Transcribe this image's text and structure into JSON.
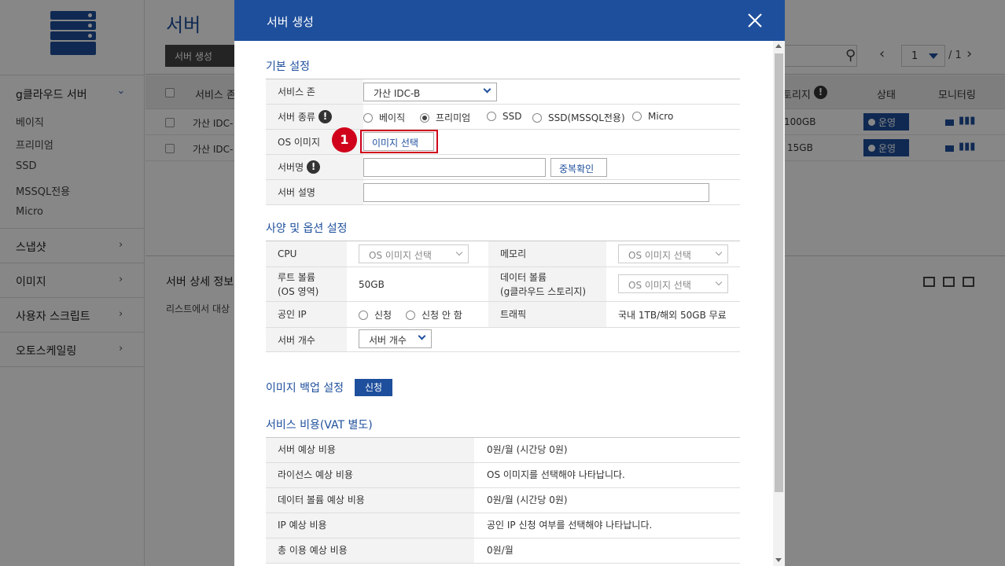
{
  "background": {
    "page_title": "서버",
    "create_button": "서버 생성",
    "pagination": {
      "current": "1",
      "total": "/ 1"
    },
    "sidebar": {
      "groups": [
        {
          "label": "g클라우드 서버",
          "expanded": true
        },
        {
          "label": "스냅샷"
        },
        {
          "label": "이미지"
        },
        {
          "label": "사용자 스크립트"
        },
        {
          "label": "오토스케일링"
        }
      ],
      "sub_items": [
        "베이직",
        "프리미엄",
        "SSD",
        "MSSQL전용",
        "Micro"
      ]
    },
    "table": {
      "headers": {
        "zone": "서비스 존",
        "storage": "토리지",
        "status": "상태",
        "monitoring": "모니터링"
      },
      "rows": [
        {
          "zone": "가산 IDC-",
          "storage": "100GB",
          "status": "운영"
        },
        {
          "zone": "가산 IDC-",
          "storage": "15GB",
          "status": "운영"
        }
      ]
    },
    "detail": {
      "title": "서버 상세 정보",
      "hint": "리스트에서 대상"
    }
  },
  "modal": {
    "title": "서버 생성",
    "basic": {
      "section_title": "기본 설정",
      "zone_label": "서비스 존",
      "zone_value": "가산 IDC-B",
      "type_label": "서버 종류",
      "types": [
        {
          "label": "베이직",
          "selected": false
        },
        {
          "label": "프리미엄",
          "selected": true
        },
        {
          "label": "SSD",
          "selected": false
        },
        {
          "label": "SSD(MSSQL전용)",
          "selected": false
        },
        {
          "label": "Micro",
          "selected": false
        }
      ],
      "os_label": "OS 이미지",
      "os_button": "이미지 선택",
      "step_number": "1",
      "name_label": "서버명",
      "name_value": "",
      "dup_check": "중복확인",
      "desc_label": "서버 설명",
      "desc_value": ""
    },
    "spec": {
      "section_title": "사양 및 옵션 설정",
      "cpu_label": "CPU",
      "cpu_value": "OS 이미지 선택",
      "memory_label": "메모리",
      "memory_value": "OS 이미지 선택",
      "root_label_1": "루트 볼륨",
      "root_label_2": "(OS 영역)",
      "root_value": "50GB",
      "data_label_1": "데이터 볼륨",
      "data_label_2": "(g클라우드 스토리지)",
      "data_value": "OS 이미지 선택",
      "ip_label": "공인 IP",
      "ip_options": [
        {
          "label": "신청",
          "selected": false
        },
        {
          "label": "신청 안 함",
          "selected": false
        }
      ],
      "traffic_label": "트래픽",
      "traffic_value": "국내 1TB/해외 50GB 무료",
      "count_label": "서버 개수",
      "count_value": "서버 개수"
    },
    "backup": {
      "section_title": "이미지 백업 설정",
      "apply_button": "신청"
    },
    "cost": {
      "section_title": "서비스 비용(VAT 별도)",
      "rows": [
        {
          "label": "서버 예상 비용",
          "value": "0원/월 (시간당 0원)"
        },
        {
          "label": "라이선스 예상 비용",
          "value": "OS 이미지를 선택해야 나타납니다."
        },
        {
          "label": "데이터 볼륨 예상 비용",
          "value": "0원/월 (시간당 0원)"
        },
        {
          "label": "IP 예상 비용",
          "value": "공인 IP 신청 여부를 선택해야 나타납니다."
        },
        {
          "label": "총 이용 예상 비용",
          "value": "0원/월"
        }
      ]
    }
  },
  "colors": {
    "brand": "#1e4f9c",
    "highlight": "#d0021b",
    "overlay": "rgba(0,0,0,0.47)"
  }
}
